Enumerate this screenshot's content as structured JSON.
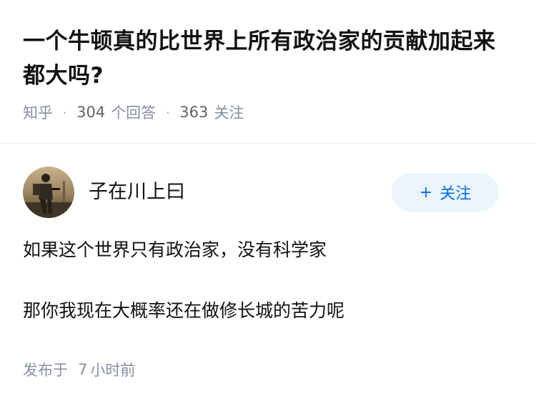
{
  "question": {
    "title": "一个牛顿真的比世界上所有政治家的贡献加起来都大吗?",
    "source": "知乎",
    "answer_count": "304",
    "answer_label": "个回答",
    "follower_count": "363",
    "follower_label": "关注"
  },
  "answer": {
    "author_name": "子在川上曰",
    "follow_button": "关注",
    "follow_icon": "plus-icon",
    "paragraphs": [
      "如果这个世界只有政治家，没有科学家",
      "那你我现在大概率还在做修长城的苦力呢"
    ],
    "published_label": "发布于",
    "published_time_num": "7",
    "published_time_unit": "小时前"
  },
  "colors": {
    "accent": "#056de8",
    "follow_bg": "#ebf5fd",
    "meta": "#8590a6"
  }
}
